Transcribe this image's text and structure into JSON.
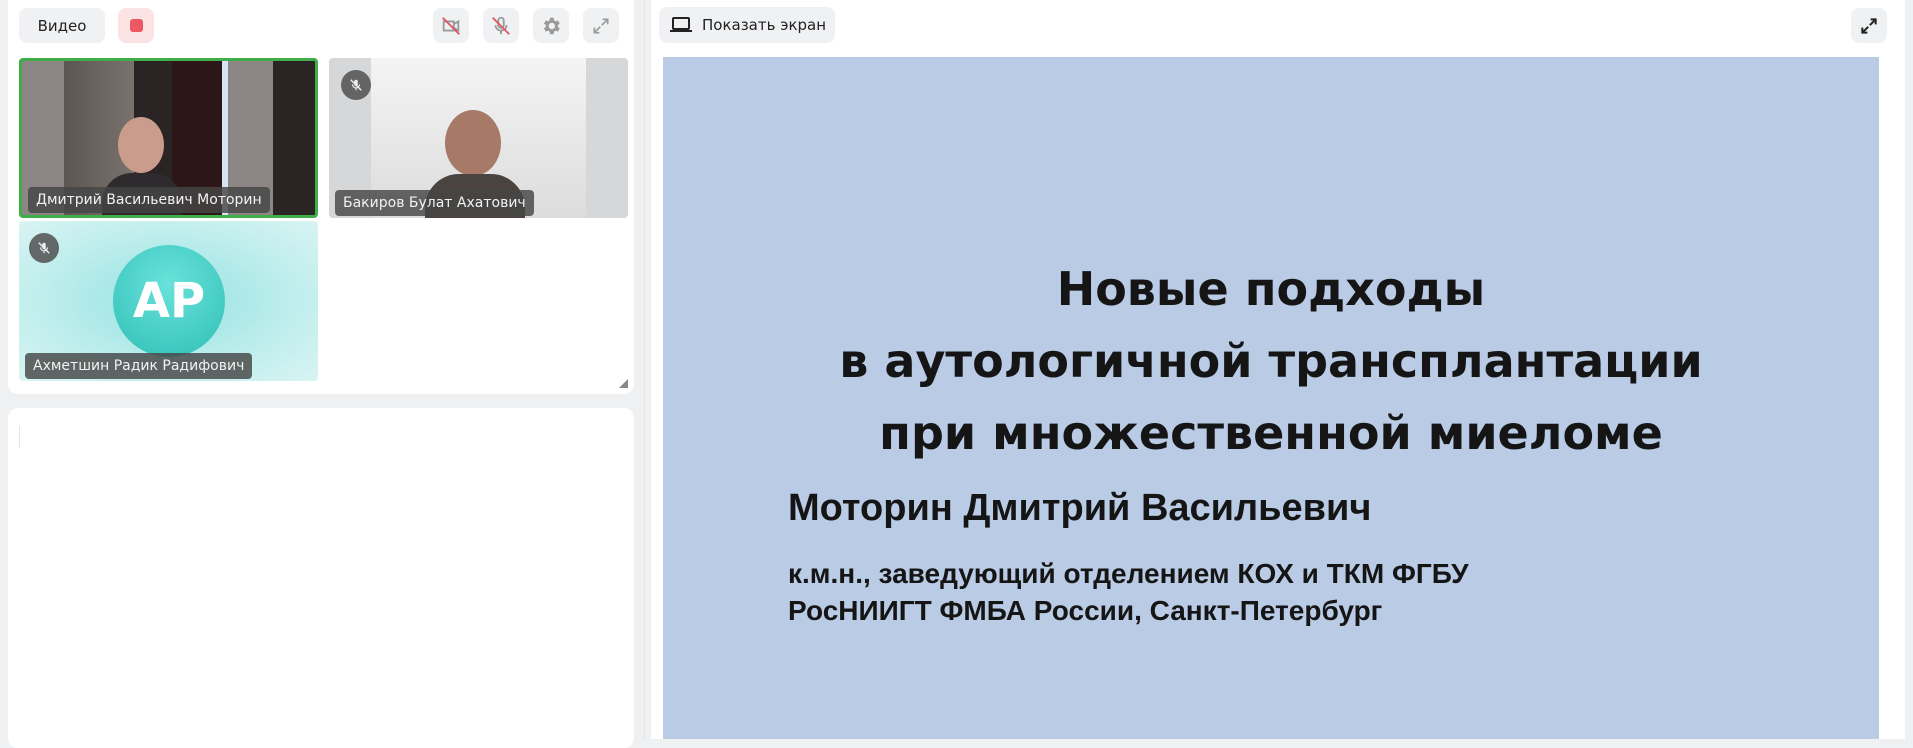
{
  "toolbar": {
    "video_label": "Видео",
    "icons": [
      "camera-off-icon",
      "mic-off-icon",
      "gear-icon",
      "fullscreen-icon"
    ]
  },
  "participants": [
    {
      "name": "Дмитрий Васильевич Моторин",
      "speaking": true,
      "muted": false
    },
    {
      "name": "Бакиров Булат Ахатович",
      "speaking": false,
      "muted": true
    },
    {
      "name": "Ахметшин Радик Радифович",
      "initials": "АР",
      "speaking": false,
      "muted": true
    }
  ],
  "share": {
    "show_screen_label": "Показать экран"
  },
  "slide": {
    "title_lines": [
      "Новые подходы",
      "в аутологичной трансплантации",
      "при множественной миеломе"
    ],
    "author": "Моторин Дмитрий Васильевич",
    "affiliation_lines": [
      "к.м.н., заведующий отделением КОХ и ТКМ ФГБУ",
      "РосНИИГТ  ФМБА России, Санкт-Петербург"
    ]
  },
  "colors": {
    "accent_speaking": "#3fae49",
    "record": "#ec5863",
    "slide_bg": "#b9cbe5"
  }
}
